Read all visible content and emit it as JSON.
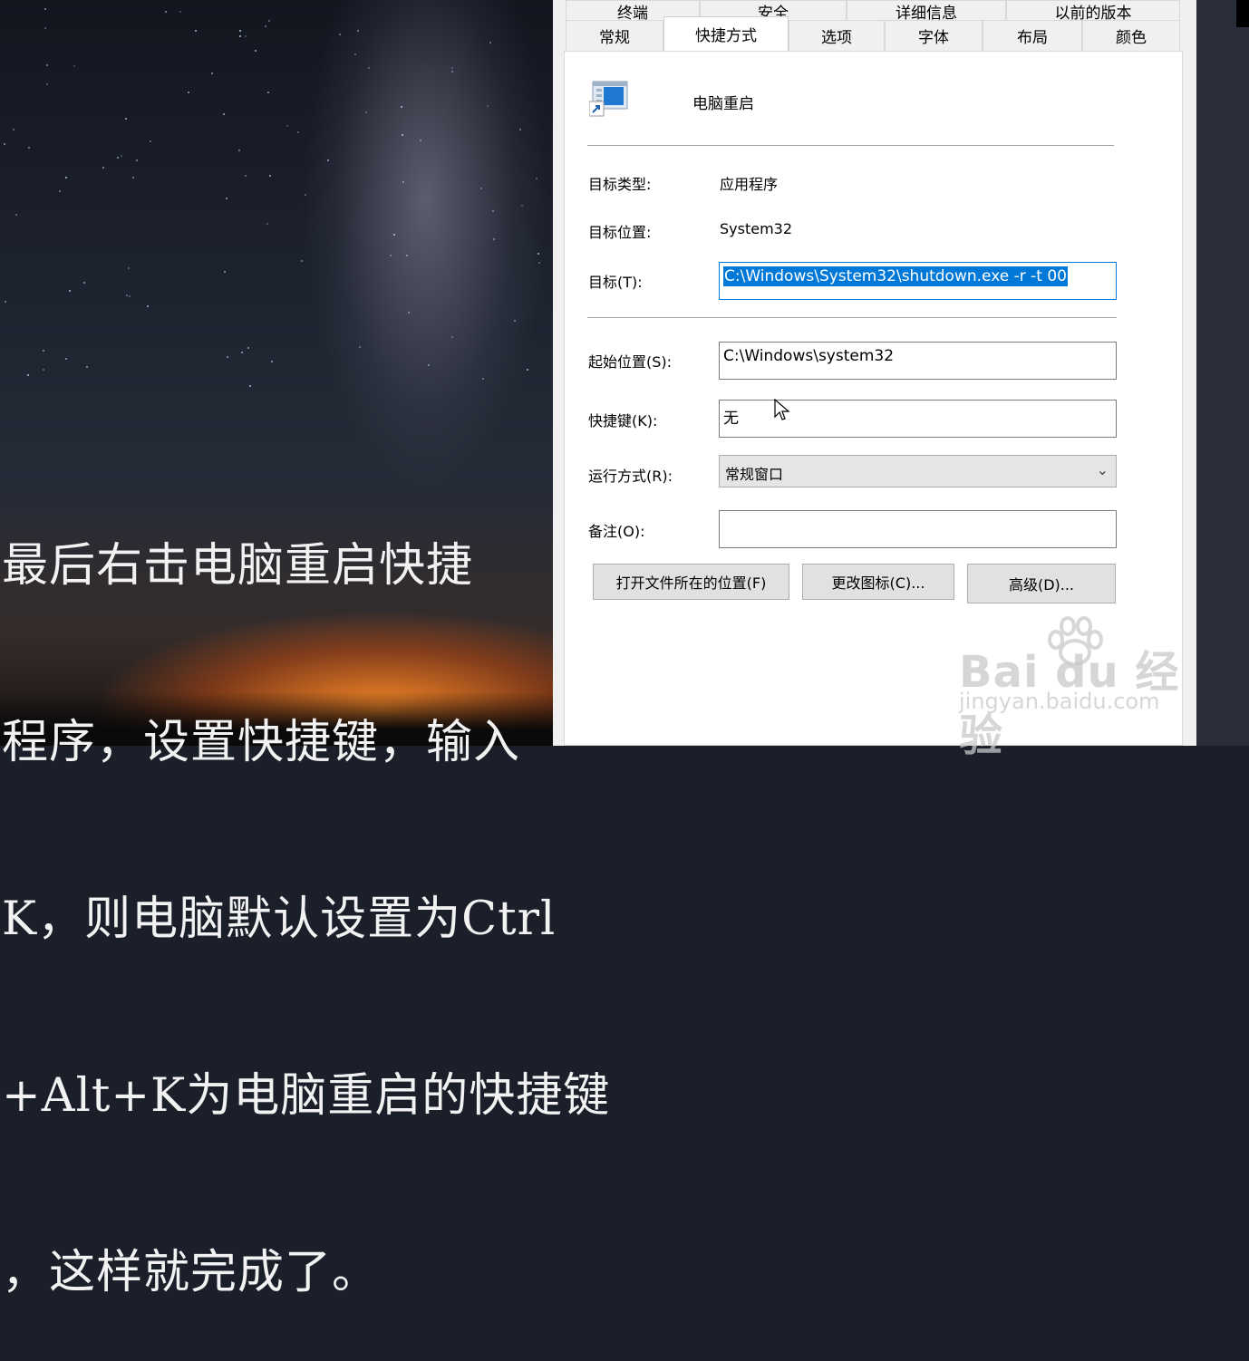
{
  "caption": {
    "lines": [
      "最后右击电脑重启快捷",
      "程序，设置快捷键，输入",
      "K，则电脑默认设置为Ctrl",
      "+Alt+K为电脑重启的快捷键",
      "，这样就完成了。"
    ]
  },
  "tabs_top": [
    "终端",
    "安全",
    "详细信息",
    "以前的版本"
  ],
  "tabs_bottom": [
    "常规",
    "快捷方式",
    "选项",
    "字体",
    "布局",
    "颜色"
  ],
  "active_tab": "快捷方式",
  "shortcut": {
    "name": "电脑重启",
    "target_type_label": "目标类型:",
    "target_type_value": "应用程序",
    "target_location_label": "目标位置:",
    "target_location_value": "System32",
    "target_label": "目标(T):",
    "target_value": "C:\\Windows\\System32\\shutdown.exe -r -t 00",
    "start_in_label": "起始位置(S):",
    "start_in_value": "C:\\Windows\\system32",
    "hotkey_label": "快捷键(K):",
    "hotkey_value": "无",
    "run_label": "运行方式(R):",
    "run_value": "常规窗口",
    "comment_label": "备注(O):",
    "comment_value": ""
  },
  "buttons": {
    "open_location": "打开文件所在的位置(F)",
    "change_icon": "更改图标(C)...",
    "advanced": "高级(D)..."
  },
  "watermark": {
    "main": "Bai du 经验",
    "sub": "jingyan.baidu.com"
  },
  "colors": {
    "accent": "#0078d7",
    "dialog_bg": "#f0f0f0",
    "panel_bg": "#ffffff"
  }
}
